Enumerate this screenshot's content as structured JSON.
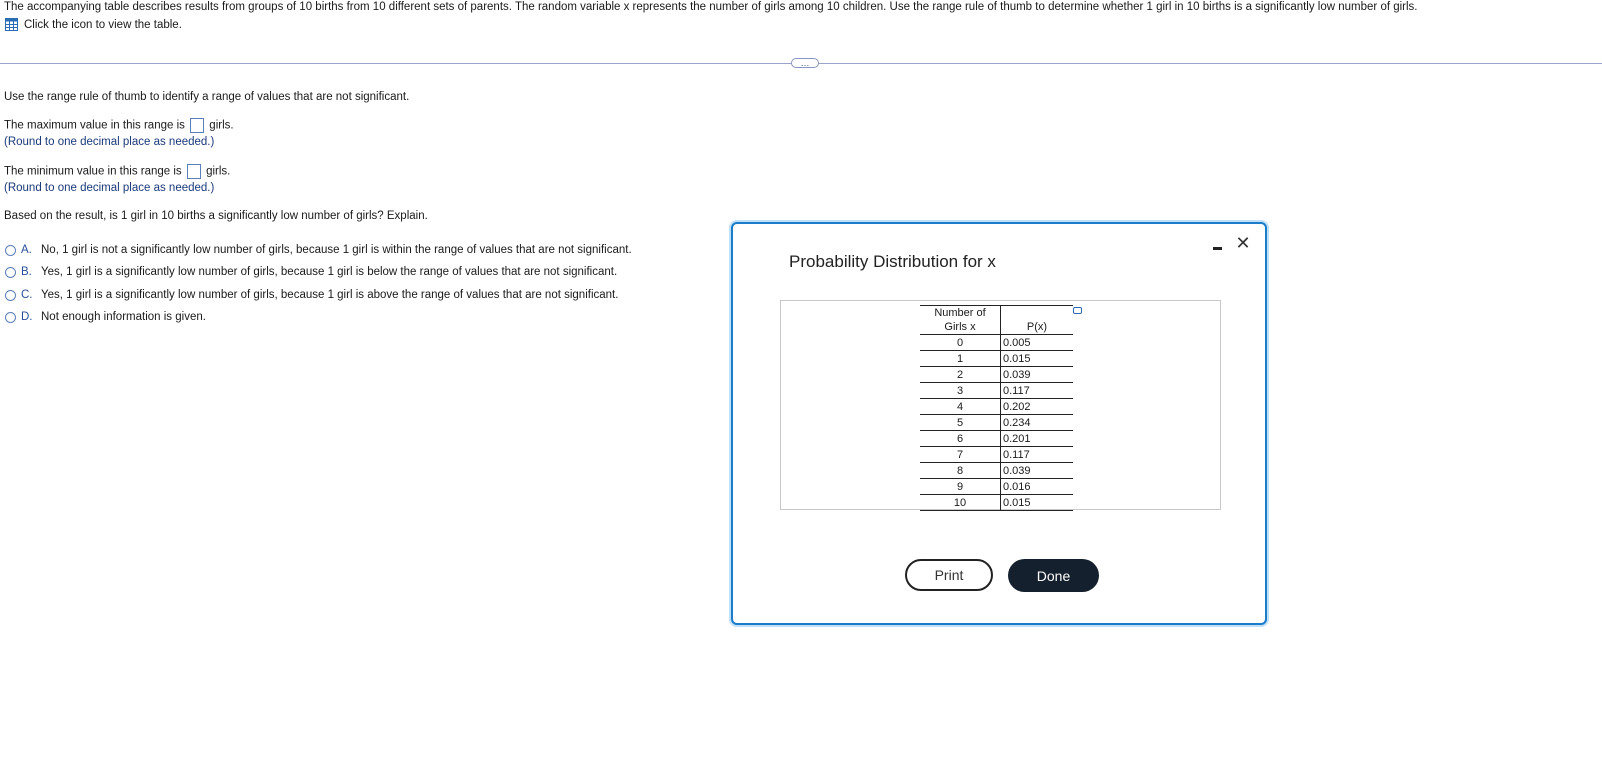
{
  "intro": {
    "text": "The accompanying table describes results from groups of 10 births from 10 different sets of parents. The random variable x represents the number of girls among 10 children. Use the range rule of thumb to determine whether 1 girl in 10 births is a significantly low number of girls.",
    "link_label": "Click the icon to view the table."
  },
  "question": {
    "instruction": "Use the range rule of thumb to identify a range of values that are not significant.",
    "max_prefix": "The maximum value in this range is",
    "max_suffix": "girls.",
    "max_note": "(Round to one decimal place as needed.)",
    "max_value": "",
    "min_prefix": "The minimum value in this range is",
    "min_suffix": "girls.",
    "min_note": "(Round to one decimal place as needed.)",
    "min_value": "",
    "explain_prompt": "Based on the result, is 1 girl in 10 births a significantly low number of girls? Explain."
  },
  "options": [
    {
      "letter": "A.",
      "text": "No, 1 girl is not a significantly low number of girls, because 1 girl is within the range of values that are not significant."
    },
    {
      "letter": "B.",
      "text": "Yes, 1 girl is a significantly low number of girls, because 1 girl is below the range of values that are not significant."
    },
    {
      "letter": "C.",
      "text": "Yes, 1 girl is a significantly low number of girls, because 1 girl is above the range of values that are not significant."
    },
    {
      "letter": "D.",
      "text": "Not enough information is given."
    }
  ],
  "expand_handle": "…",
  "modal": {
    "title": "Probability Distribution for x",
    "close_glyph": "✕",
    "table": {
      "header_x_line1": "Number of",
      "header_x_line2": "Girls x",
      "header_p": "P(x)",
      "rows": [
        {
          "x": "0",
          "p": "0.005"
        },
        {
          "x": "1",
          "p": "0.015"
        },
        {
          "x": "2",
          "p": "0.039"
        },
        {
          "x": "3",
          "p": "0.117"
        },
        {
          "x": "4",
          "p": "0.202"
        },
        {
          "x": "5",
          "p": "0.234"
        },
        {
          "x": "6",
          "p": "0.201"
        },
        {
          "x": "7",
          "p": "0.117"
        },
        {
          "x": "8",
          "p": "0.039"
        },
        {
          "x": "9",
          "p": "0.016"
        },
        {
          "x": "10",
          "p": "0.015"
        }
      ]
    },
    "print_label": "Print",
    "done_label": "Done"
  },
  "colors": {
    "accent_blue": "#1b7cc9",
    "link_blue": "#2a4f9a",
    "done_bg": "#15202e"
  }
}
